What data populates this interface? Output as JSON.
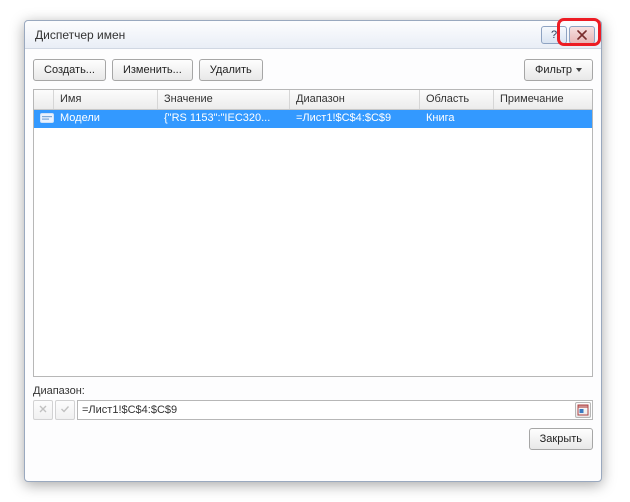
{
  "titlebar": {
    "title": "Диспетчер имен"
  },
  "toolbar": {
    "create": "Создать...",
    "edit": "Изменить...",
    "delete": "Удалить",
    "filter": "Фильтр"
  },
  "grid": {
    "headers": {
      "name": "Имя",
      "value": "Значение",
      "range": "Диапазон",
      "scope": "Область",
      "note": "Примечание"
    },
    "rows": [
      {
        "name": "Модели",
        "value": "{\"RS 1153\":\"IEC320...",
        "range": "=Лист1!$C$4:$C$9",
        "scope": "Книга",
        "note": ""
      }
    ]
  },
  "range_section": {
    "label": "Диапазон:",
    "value": "=Лист1!$C$4:$C$9"
  },
  "footer": {
    "close": "Закрыть"
  }
}
